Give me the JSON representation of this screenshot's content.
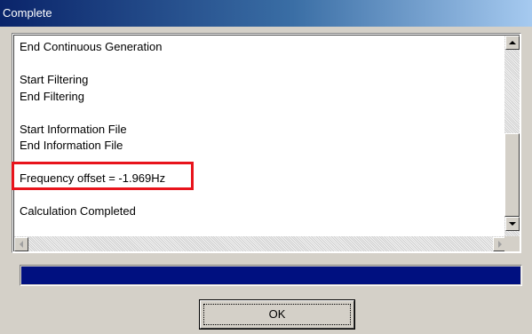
{
  "window": {
    "title": "Complete"
  },
  "log": {
    "lines": [
      "End Continuous Generation",
      "",
      "Start Filtering",
      "End Filtering",
      "",
      "Start Information File",
      "End Information File",
      "",
      "Frequency offset = -1.969Hz",
      "",
      "Calculation Completed"
    ],
    "highlight_color": "#e8141c"
  },
  "progress": {
    "value": 1.0,
    "color": "#001080"
  },
  "buttons": {
    "ok_label": "OK"
  },
  "icons": {
    "scroll_up": "scroll-up-arrow-icon",
    "scroll_down": "scroll-down-arrow-icon",
    "scroll_left": "scroll-left-arrow-icon",
    "scroll_right": "scroll-right-arrow-icon"
  }
}
